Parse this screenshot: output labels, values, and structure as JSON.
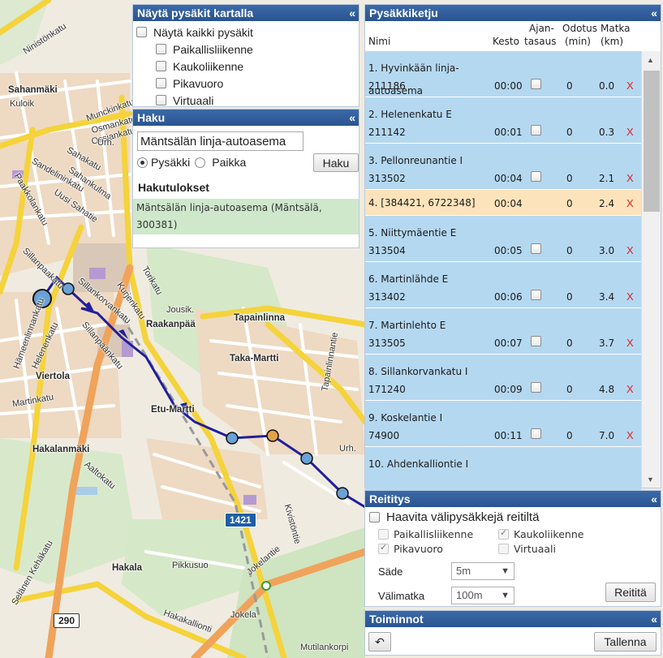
{
  "map": {
    "labels": [
      {
        "text": "Ninistönkatu",
        "cls": "rot",
        "rot": -33
      },
      {
        "text": "Sahanmäki",
        "cls": "big"
      },
      {
        "text": "Kuloik",
        "cls": ""
      },
      {
        "text": "Munckinkatu",
        "cls": "rot",
        "rot": -20
      },
      {
        "text": "Osmankatu",
        "cls": "rot",
        "rot": -15
      },
      {
        "text": "Ossiankatu",
        "cls": "rot",
        "rot": -15
      },
      {
        "text": "Sahakatu",
        "cls": "rot",
        "rot": 30
      },
      {
        "text": "Sandelininkatu",
        "cls": "rot",
        "rot": 30
      },
      {
        "text": "Sahankulma",
        "cls": "rot",
        "rot": 35
      },
      {
        "text": "Uusi Sahatie",
        "cls": "rot",
        "rot": 35
      },
      {
        "text": "Paakkolankatu",
        "cls": "rot",
        "rot": 60
      },
      {
        "text": "Sillanpaakatu",
        "cls": "rot",
        "rot": 45
      },
      {
        "text": "Sillankorvankatu",
        "cls": "rot",
        "rot": 40
      },
      {
        "text": "Hämeenlinnankatu",
        "cls": "rot",
        "rot": -70
      },
      {
        "text": "Helenenkatu",
        "cls": "rot",
        "rot": -65
      },
      {
        "text": "Sillanpäänkatu",
        "cls": "rot",
        "rot": 50
      },
      {
        "text": "Viertola",
        "cls": "big"
      },
      {
        "text": "Torikatu",
        "cls": "rot",
        "rot": 60
      },
      {
        "text": "Kurjenkatu",
        "cls": "rot",
        "rot": 55
      },
      {
        "text": "Raakanpää",
        "cls": "big"
      },
      {
        "text": "Tapainlinna",
        "cls": "big"
      },
      {
        "text": "Taka-Martti",
        "cls": "big"
      },
      {
        "text": "Etu-Martti",
        "cls": "big"
      },
      {
        "text": "Tapainlinnantie",
        "cls": "rot",
        "rot": -80
      },
      {
        "text": "Hakalanmäki",
        "cls": "big"
      },
      {
        "text": "Martinkatu",
        "cls": "rot",
        "rot": -10
      },
      {
        "text": "Aaltokatu",
        "cls": "rot",
        "rot": 40
      },
      {
        "text": "Pikkusuo",
        "cls": ""
      },
      {
        "text": "Hakala",
        "cls": "big"
      },
      {
        "text": "Hakakallionti",
        "cls": "rot",
        "rot": 20
      },
      {
        "text": "Jokela",
        "cls": ""
      },
      {
        "text": "Mutilankorpi",
        "cls": ""
      },
      {
        "text": "Selänen Kehäkatu",
        "cls": "rot",
        "rot": -60
      },
      {
        "text": "Jokelantie",
        "cls": "rot",
        "rot": -40
      },
      {
        "text": "Kivistöntie",
        "cls": "rot",
        "rot": 75
      },
      {
        "text": "Urh.",
        "cls": ""
      },
      {
        "text": "Urh.",
        "cls": ""
      },
      {
        "text": "Jousik.",
        "cls": ""
      }
    ],
    "shields": [
      {
        "text": "1421",
        "style": "blue"
      },
      {
        "text": "290",
        "style": "white"
      }
    ]
  },
  "filter_panel": {
    "title": "Näytä pysäkit kartalla",
    "collapse": "«",
    "show_all": "Näytä kaikki pysäkit",
    "options": [
      {
        "label": "Paikallisliikenne",
        "checked": false
      },
      {
        "label": "Kaukoliikenne",
        "checked": false
      },
      {
        "label": "Pikavuoro",
        "checked": false
      },
      {
        "label": "Virtuaali",
        "checked": false
      }
    ]
  },
  "search_panel": {
    "title": "Haku",
    "collapse": "«",
    "query": "Mäntsälän linja-autoasema",
    "radio_stop": "Pysäkki",
    "radio_place": "Paikka",
    "search_button": "Haku",
    "results_title": "Hakutulokset",
    "result": "Mäntsälän linja-autoasema (Mäntsälä, 300381)"
  },
  "chain_panel": {
    "title": "Pysäkkiketju",
    "collapse": "«",
    "headers": {
      "nimi": "Nimi",
      "kesto": "Kesto",
      "ajan1": "Ajan-",
      "ajan2": "tasaus",
      "odotus1": "Odotus",
      "odotus2": "(min)",
      "matka1": "Matka",
      "matka2": "(km)"
    },
    "stops": [
      {
        "name": "1. Hyvinkään linja-autoasema",
        "code": "211186",
        "kesto": "00:00",
        "odotus": "0",
        "matka": "0.0",
        "del": "X"
      },
      {
        "name": "2. Helenenkatu E",
        "code": "211142",
        "kesto": "00:01",
        "odotus": "0",
        "matka": "0.3",
        "del": "X"
      },
      {
        "name": "3. Pellonreunantie I",
        "code": "313502",
        "kesto": "00:04",
        "odotus": "0",
        "matka": "2.1",
        "del": "X"
      },
      {
        "name": "4. [384421, 6722348]",
        "code": "",
        "kesto": "00:04",
        "odotus": "0",
        "matka": "2.4",
        "del": "X",
        "highlight": true
      },
      {
        "name": "5. Niittymäentie E",
        "code": "313504",
        "kesto": "00:05",
        "odotus": "0",
        "matka": "3.0",
        "del": "X"
      },
      {
        "name": "6. Martinlähde E",
        "code": "313402",
        "kesto": "00:06",
        "odotus": "0",
        "matka": "3.4",
        "del": "X"
      },
      {
        "name": "7. Martinlehto E",
        "code": "313505",
        "kesto": "00:07",
        "odotus": "0",
        "matka": "3.7",
        "del": "X"
      },
      {
        "name": "8. Sillankorvankatu I",
        "code": "171240",
        "kesto": "00:09",
        "odotus": "0",
        "matka": "4.8",
        "del": "X"
      },
      {
        "name": "9. Koskelantie I",
        "code": "74900",
        "kesto": "00:11",
        "odotus": "0",
        "matka": "7.0",
        "del": "X"
      },
      {
        "name": "10. Ahdenkalliontie I",
        "code": "",
        "kesto": "",
        "odotus": "",
        "matka": "",
        "del": ""
      }
    ]
  },
  "routing_panel": {
    "title": "Reititys",
    "collapse": "«",
    "avoid": "Haavita välipysäkkejä reitiltä",
    "options": [
      {
        "label": "Paikallisliikenne",
        "checked": false
      },
      {
        "label": "Kaukoliikenne",
        "checked": true
      },
      {
        "label": "Pikavuoro",
        "checked": true
      },
      {
        "label": "Virtuaali",
        "checked": false
      }
    ],
    "radius_label": "Säde",
    "radius_value": "5m",
    "gap_label": "Välimatka",
    "gap_value": "100m",
    "route_button": "Reititä"
  },
  "actions_panel": {
    "title": "Toiminnot",
    "collapse": "«",
    "undo_icon": "↶",
    "save_button": "Tallenna"
  }
}
